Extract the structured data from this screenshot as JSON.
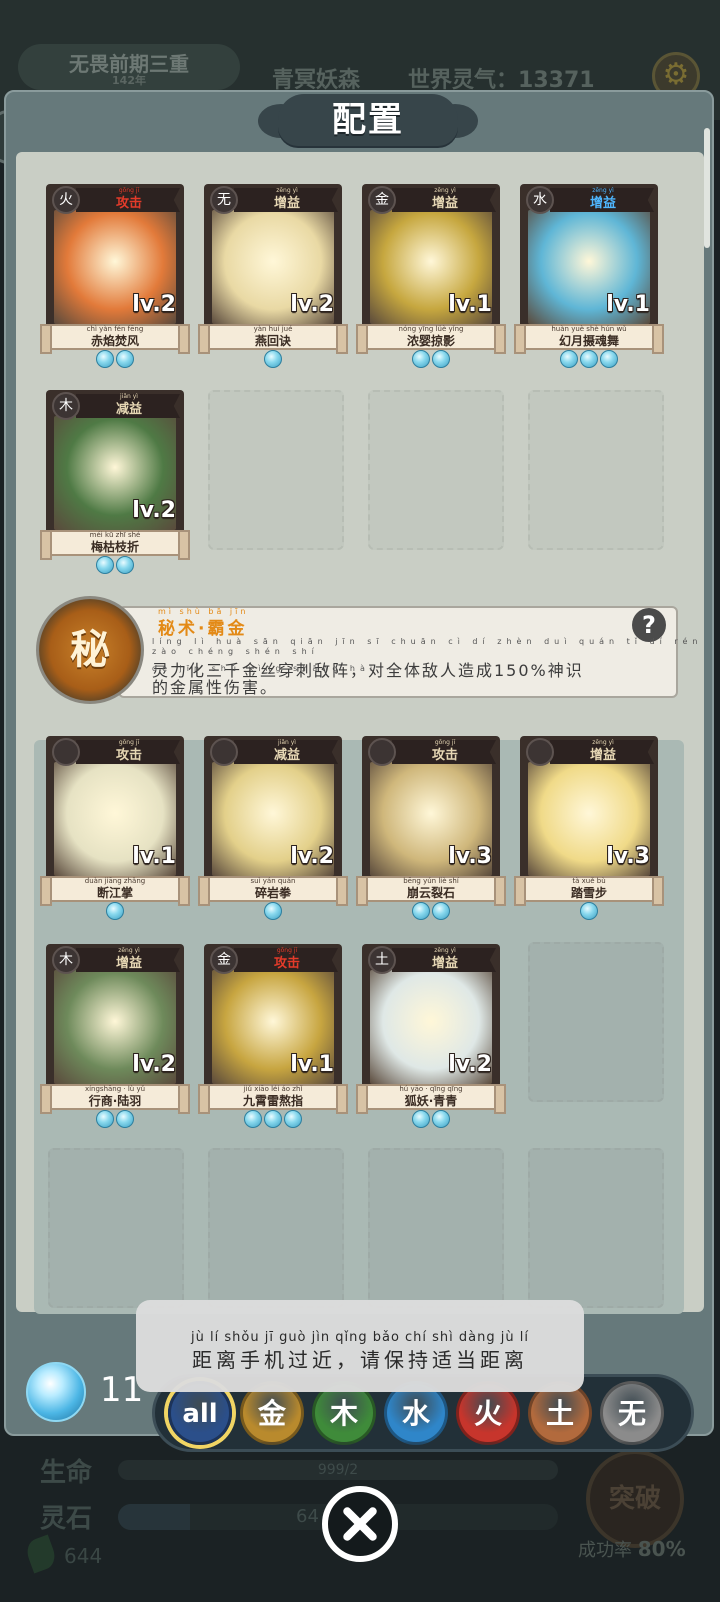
{
  "hud": {
    "realm": "无畏前期三重",
    "realm_sub": "142年",
    "area": "青冥妖森",
    "world_label": "世界灵气：",
    "world_value": "13371",
    "life_label": "生命",
    "life_value": "999/2",
    "stone_label": "灵石",
    "stone_value": "64",
    "leaf_value": "644",
    "break_label": "突破",
    "rate_label": "成功率",
    "rate_value": "80%"
  },
  "panel": {
    "title": "配置"
  },
  "equipped": [
    {
      "type": "攻击",
      "type_py": "gōng jī",
      "type_color": "#e33b2a",
      "elem": "火",
      "elem_icon": "flame-icon",
      "level": "lv.2",
      "name": "赤焰焚风",
      "name_py": "chì yàn fén fēng",
      "gems": 2,
      "art_color": "#e27a3a"
    },
    {
      "type": "增益",
      "type_py": "zēng yì",
      "type_color": "#e6d7b4",
      "elem": "无",
      "elem_icon": "none-icon",
      "level": "lv.2",
      "name": "燕回诀",
      "name_py": "yàn huí jué",
      "gems": 1,
      "art_color": "#e9d9a4"
    },
    {
      "type": "增益",
      "type_py": "zēng yì",
      "type_color": "#e6d7b4",
      "elem": "金",
      "elem_icon": "metal-icon",
      "level": "lv.1",
      "name": "浓婴掠影",
      "name_py": "nóng yīng lüè yǐng",
      "gems": 2,
      "art_color": "#c6a73f"
    },
    {
      "type": "增益",
      "type_py": "zēng yì",
      "type_color": "#4fb7ff",
      "elem": "水",
      "elem_icon": "water-icon",
      "level": "lv.1",
      "name": "幻月摄魂舞",
      "name_py": "huàn yuè shè hún wǔ",
      "gems": 3,
      "art_color": "#5fb6d6"
    },
    {
      "type": "减益",
      "type_py": "jiǎn yì",
      "type_color": "#e6d7b4",
      "elem": "木",
      "elem_icon": "wood-icon",
      "level": "lv.2",
      "name": "梅枯枝折",
      "name_py": "méi kū zhī shé",
      "gems": 2,
      "art_color": "#4f7a45"
    }
  ],
  "secret": {
    "title_py": "mì shù  bā jīn",
    "title": "秘术·霸金",
    "glyph": "秘",
    "line1_py": "líng lì huà sān qiān jīn sī chuān cì dí zhèn   duì quán tǐ dí rén zào chéng      shén shí",
    "line1": "灵力化三千金丝穿刺敌阵，对全体敌人造成150%神识",
    "line2_py": "de jīn shǔ xìng shāng hài",
    "line2": "的金属性伤害。",
    "help": "?"
  },
  "inventory": [
    {
      "type": "攻击",
      "type_py": "gōng jī",
      "type_color": "#e6d7b4",
      "elem": "",
      "elem_icon": "locked-icon",
      "level": "lv.1",
      "name": "断江掌",
      "name_py": "duàn jiāng zhǎng",
      "gems": 1,
      "art_color": "#e6e2c3"
    },
    {
      "type": "减益",
      "type_py": "jiǎn yì",
      "type_color": "#e6d7b4",
      "elem": "",
      "elem_icon": "locked-icon",
      "level": "lv.2",
      "name": "碎岩拳",
      "name_py": "suì yán quán",
      "gems": 1,
      "art_color": "#e3d08a"
    },
    {
      "type": "攻击",
      "type_py": "gōng jī",
      "type_color": "#e6d7b4",
      "elem": "",
      "elem_icon": "locked-icon",
      "level": "lv.3",
      "name": "崩云裂石",
      "name_py": "bēng yún liè shí",
      "gems": 2,
      "art_color": "#cfb77b"
    },
    {
      "type": "增益",
      "type_py": "zēng yì",
      "type_color": "#e6d7b4",
      "elem": "",
      "elem_icon": "locked-icon",
      "level": "lv.3",
      "name": "踏雪步",
      "name_py": "tà xuě bù",
      "gems": 1,
      "art_color": "#f0da88"
    },
    {
      "type": "增益",
      "type_py": "zēng yì",
      "type_color": "#e6d7b4",
      "elem": "木",
      "elem_icon": "wood-icon",
      "level": "lv.2",
      "name": "行商·陆羽",
      "name_py": "xíngshāng · lù yǔ",
      "gems": 2,
      "art_color": "#6e8a5b"
    },
    {
      "type": "攻击",
      "type_py": "gōng jī",
      "type_color": "#e33b2a",
      "elem": "金",
      "elem_icon": "metal-icon",
      "level": "lv.1",
      "name": "九霄雷熬指",
      "name_py": "jiǔ xiāo léi áo zhǐ",
      "gems": 3,
      "art_color": "#c7a540"
    },
    {
      "type": "增益",
      "type_py": "zēng yì",
      "type_color": "#e6d7b4",
      "elem": "土",
      "elem_icon": "earth-icon",
      "level": "lv.2",
      "name": "狐妖·青青",
      "name_py": "hú yāo · qīng qīng",
      "gems": 2,
      "art_color": "#dfe8e6"
    }
  ],
  "filters": [
    {
      "label": "all",
      "color": "#2b4f8a",
      "selected": true
    },
    {
      "label": "金",
      "color": "#b98a2d"
    },
    {
      "label": "木",
      "color": "#3f8b3a"
    },
    {
      "label": "水",
      "color": "#2f86c9"
    },
    {
      "label": "火",
      "color": "#c7352c"
    },
    {
      "label": "土",
      "color": "#b26a3d"
    },
    {
      "label": "无",
      "color": "#8b8b8b"
    }
  ],
  "gem_count": "11",
  "toast": {
    "pinyin": "jù  lí shǒu  jī  guò  jìn      qǐng bǎo  chí  shì dàng  jù   lí",
    "text": "距离手机过近，请保持适当距离"
  }
}
